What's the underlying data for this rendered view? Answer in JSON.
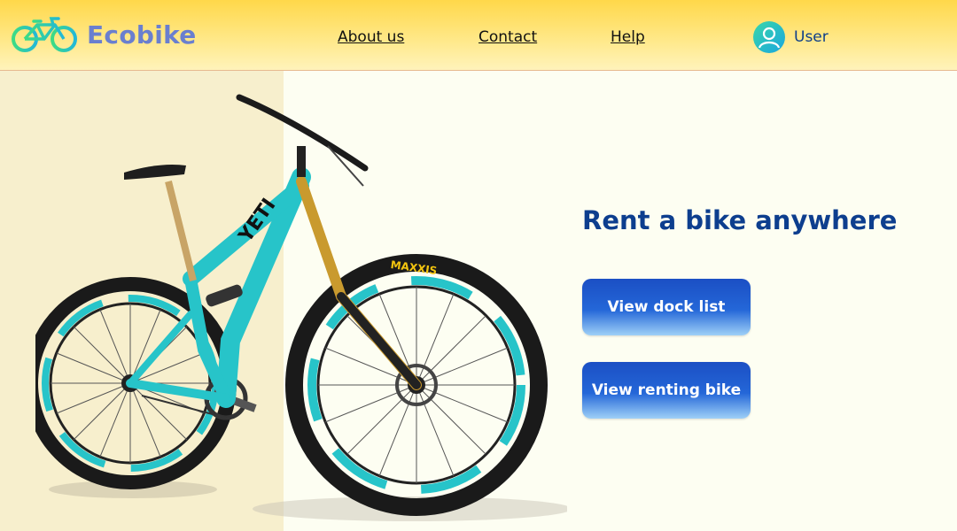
{
  "brand": {
    "name": "Ecobike",
    "logo_icon": "bicycle-logo-icon"
  },
  "nav": {
    "links": [
      {
        "label": "About us"
      },
      {
        "label": "Contact"
      },
      {
        "label": "Help"
      }
    ],
    "user": {
      "label": "User",
      "icon": "user-avatar-icon"
    }
  },
  "hero": {
    "headline": "Rent a bike anywhere",
    "buttons": [
      {
        "label": "View dock list"
      },
      {
        "label": "View renting bike"
      }
    ],
    "image": {
      "tire_brand": "MAXXIS",
      "frame_text": "YETI"
    }
  },
  "colors": {
    "header_top": "#ffd84a",
    "header_bottom": "#fff3bb",
    "brand_text": "#6a7fcf",
    "headline": "#0d3e8e",
    "button": "#2467d8",
    "bike_frame": "#27c4c9",
    "left_panel": "#f7efcd",
    "right_panel": "#fdfef2"
  }
}
